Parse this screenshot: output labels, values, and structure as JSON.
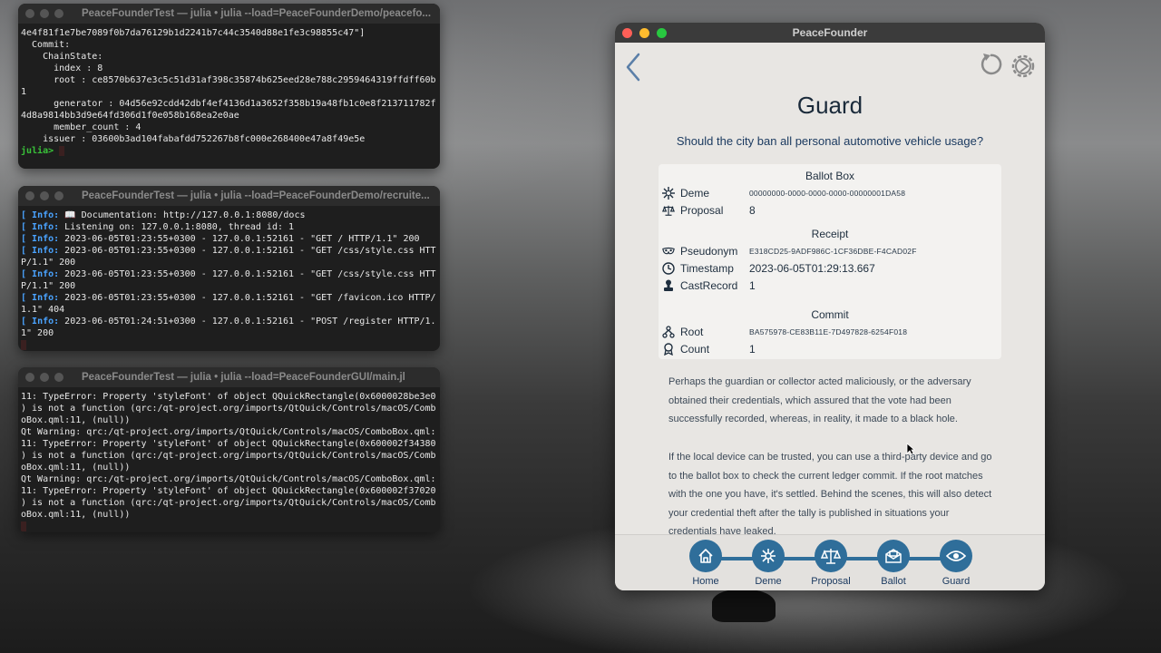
{
  "terminals": [
    {
      "title": "PeaceFounderTest — julia • julia --load=PeaceFounderDemo/peacefo...",
      "lines": [
        "4e4f81f1e7be7089f0b7da76129b1d2241b7c44c3540d88e1fe3c98855c47\"]",
        "  Commit:",
        "    ChainState:",
        "      index : 8",
        "      root : ce8570b637e3c5c51d31af398c35874b625eed28e788c2959464319ffdff60b",
        "1",
        "      generator : 04d56e92cdd42dbf4ef4136d1a3652f358b19a48fb1c0e8f213711782f",
        "4d8a9814bb3d9e64fd306d1f0e058b168ea2e0ae",
        "      member_count : 4",
        "    issuer : 03600b3ad104fabafdd752267b8fc000e268400e47a8f49e5e",
        ""
      ],
      "prompt": "julia>"
    },
    {
      "title": "PeaceFounderTest — julia • julia --load=PeaceFounderDemo/recruite...",
      "info_tag": "Info:",
      "lines": [
        " 📖 Documentation: http://127.0.0.1:8080/docs",
        " Listening on: 127.0.0.1:8080, thread id: 1",
        " 2023-06-05T01:23:55+0300 - 127.0.0.1:52161 - \"GET / HTTP/1.1\" 200",
        " 2023-06-05T01:23:55+0300 - 127.0.0.1:52161 - \"GET /css/style.css HTT",
        "P/1.1\" 200",
        " 2023-06-05T01:23:55+0300 - 127.0.0.1:52161 - \"GET /css/style.css HTT",
        "P/1.1\" 200",
        " 2023-06-05T01:23:55+0300 - 127.0.0.1:52161 - \"GET /favicon.ico HTTP/",
        "1.1\" 404",
        " 2023-06-05T01:24:51+0300 - 127.0.0.1:52161 - \"POST /register HTTP/1.",
        "1\" 200"
      ]
    },
    {
      "title": "PeaceFounderTest — julia • julia --load=PeaceFounderGUI/main.jl",
      "lines": [
        "11: TypeError: Property 'styleFont' of object QQuickRectangle(0x6000028be3e0",
        ") is not a function (qrc:/qt-project.org/imports/QtQuick/Controls/macOS/Comb",
        "oBox.qml:11, (null))",
        "Qt Warning: qrc:/qt-project.org/imports/QtQuick/Controls/macOS/ComboBox.qml:",
        "11: TypeError: Property 'styleFont' of object QQuickRectangle(0x600002f34380",
        ") is not a function (qrc:/qt-project.org/imports/QtQuick/Controls/macOS/Comb",
        "oBox.qml:11, (null))",
        "Qt Warning: qrc:/qt-project.org/imports/QtQuick/Controls/macOS/ComboBox.qml:",
        "11: TypeError: Property 'styleFont' of object QQuickRectangle(0x600002f37020",
        ") is not a function (qrc:/qt-project.org/imports/QtQuick/Controls/macOS/Comb",
        "oBox.qml:11, (null))"
      ]
    }
  ],
  "app": {
    "window_title": "PeaceFounder",
    "page_title": "Guard",
    "question": "Should the city ban all personal automotive vehicle usage?",
    "ballot_box": {
      "heading": "Ballot Box",
      "deme_label": "Deme",
      "deme_value": "00000000-0000-0000-0000-00000001DA58",
      "proposal_label": "Proposal",
      "proposal_value": "8"
    },
    "receipt": {
      "heading": "Receipt",
      "pseudonym_label": "Pseudonym",
      "pseudonym_value": "E318CD25-9ADF986C-1CF36DBE-F4CAD02F",
      "timestamp_label": "Timestamp",
      "timestamp_value": "2023-06-05T01:29:13.667",
      "castrecord_label": "CastRecord",
      "castrecord_value": "1"
    },
    "commit": {
      "heading": "Commit",
      "root_label": "Root",
      "root_value": "BA575978-CE83B11E-7D497828-6254F018",
      "count_label": "Count",
      "count_value": "1"
    },
    "paragraphs": [
      "Perhaps the guardian or collector acted maliciously, or the adversary obtained their credentials, which assured that the vote had been successfully recorded, whereas, in reality, it made to a black hole.",
      "If the local device can be trusted, you can use a third-party device and go to the ballot box to check the current ledger commit. If the root matches with the one you have, it's settled. Behind the scenes, this will also detect your credential theft after the tally is published in situations your credentials have leaked."
    ],
    "nav": [
      {
        "label": "Home",
        "icon": "home-icon"
      },
      {
        "label": "Deme",
        "icon": "deme-icon"
      },
      {
        "label": "Proposal",
        "icon": "scales-icon"
      },
      {
        "label": "Ballot",
        "icon": "envelope-icon"
      },
      {
        "label": "Guard",
        "icon": "eye-icon"
      }
    ],
    "colors": {
      "accent": "#2f6e9a",
      "title_text": "#1b3a60"
    }
  }
}
